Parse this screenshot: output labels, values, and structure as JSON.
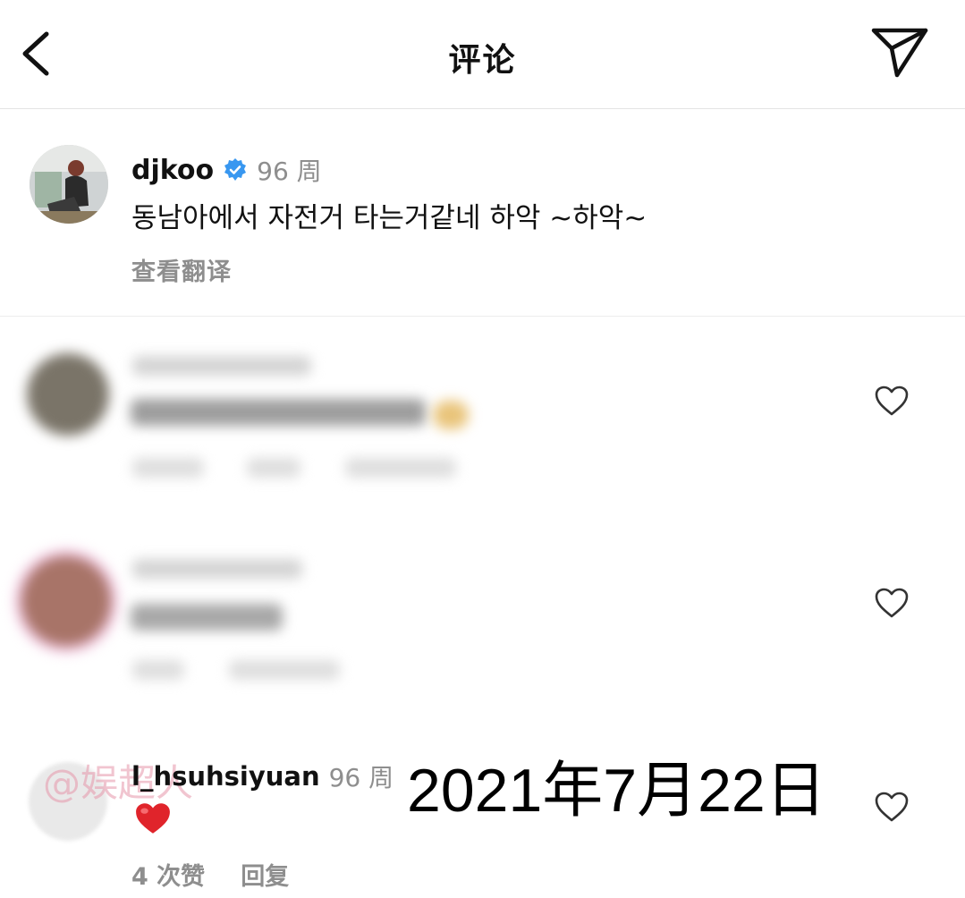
{
  "header": {
    "title": "评论"
  },
  "caption": {
    "username": "djkoo",
    "time": "96 周",
    "text": "동남아에서 자전거 타는거같네 하악 ~하악~",
    "translate_label": "查看翻译"
  },
  "comment3": {
    "username": "l_hsuhsiyuan",
    "time": "96 周",
    "likes": "4 次赞",
    "reply": "回复"
  },
  "overlay": {
    "date": "2021年7月22日",
    "watermark": "@娱超人"
  },
  "icons": {
    "back": "chevron-left-icon",
    "share": "paper-plane-icon",
    "verified": "verified-badge-icon",
    "like": "heart-outline-icon"
  },
  "colors": {
    "verified": "#3897f0",
    "muted": "#8e8e8e",
    "heart": "#e0242b"
  }
}
